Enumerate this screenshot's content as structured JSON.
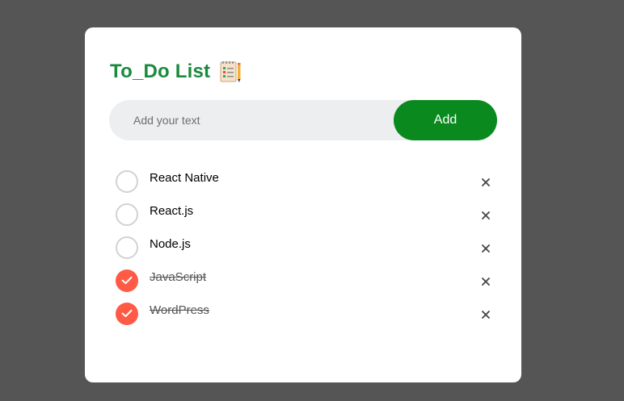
{
  "header": {
    "title": "To_Do List",
    "icon": "notepad-checklist-icon"
  },
  "input": {
    "value": "",
    "placeholder": "Add your text"
  },
  "add_button": {
    "label": "Add"
  },
  "todos": [
    {
      "text": "React Native",
      "done": false
    },
    {
      "text": "React.js",
      "done": false
    },
    {
      "text": "Node.js",
      "done": false
    },
    {
      "text": "JavaScript",
      "done": true
    },
    {
      "text": "WordPress",
      "done": true
    }
  ],
  "icons": {
    "remove": "close-icon",
    "check": "checkmark-icon"
  },
  "colors": {
    "background": "#555555",
    "card": "#ffffff",
    "title": "#1a8a3e",
    "add_button": "#0a8a1e",
    "checked": "#ff5a45",
    "input_background": "#edeef0"
  }
}
